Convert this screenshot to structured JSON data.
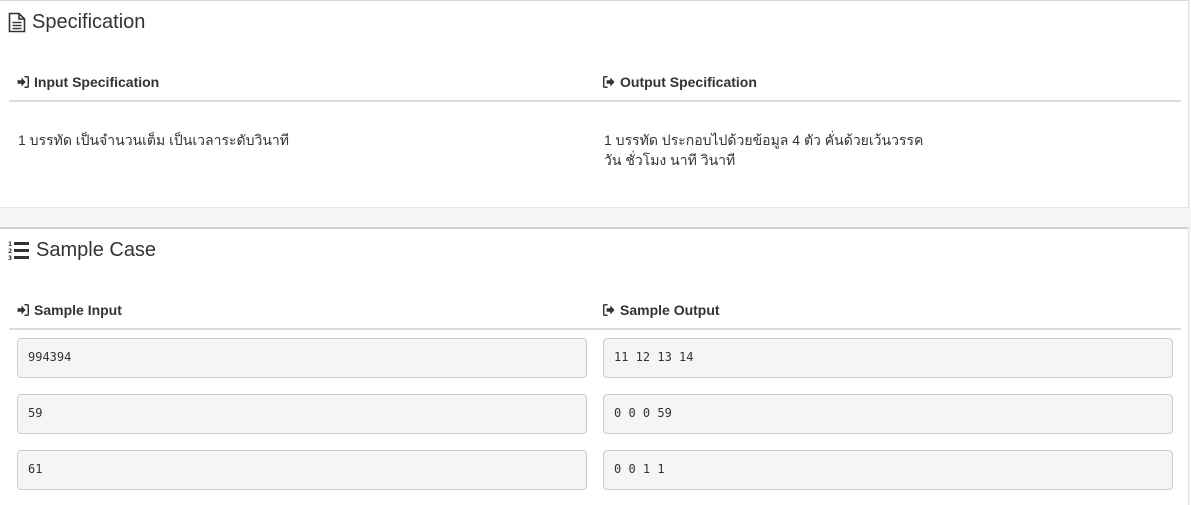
{
  "specification": {
    "title": "Specification",
    "input_heading": "Input Specification",
    "output_heading": "Output Specification",
    "input_text": [
      "1 บรรทัด เป็นจำนวนเต็ม เป็นเวลาระดับวินาที"
    ],
    "output_text": [
      "1 บรรทัด ประกอบไปด้วยข้อมูล 4 ตัว คั่นด้วยเว้นวรรค",
      "วัน ชั่วโมง นาที วินาที"
    ]
  },
  "sample_case": {
    "title": "Sample Case",
    "input_heading": "Sample Input",
    "output_heading": "Sample Output",
    "rows": [
      {
        "input": "994394",
        "output": "11 12 13 14"
      },
      {
        "input": "59",
        "output": "0 0 0 59"
      },
      {
        "input": "61",
        "output": "0 0 1 1"
      }
    ]
  },
  "icons": {
    "specification": "file-text-icon",
    "sample_case": "list-ol-icon",
    "input": "sign-in-icon",
    "output": "sign-out-icon"
  }
}
